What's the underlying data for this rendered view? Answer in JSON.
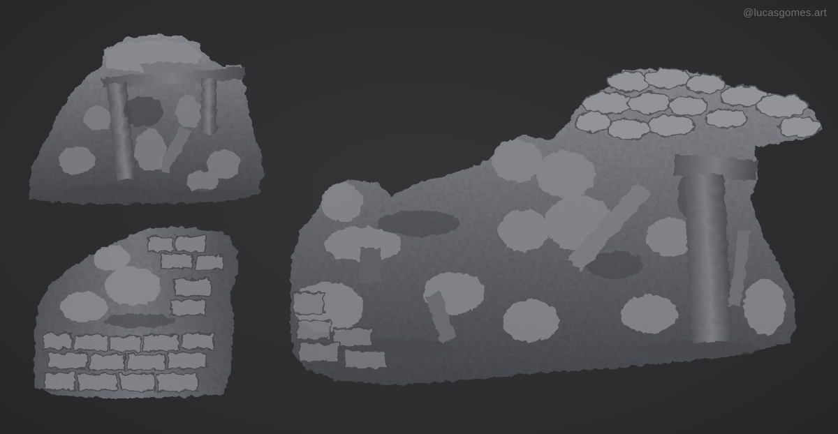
{
  "watermark": {
    "text": "@lucasgomes.art"
  },
  "colors": {
    "background": "#2d2d2f",
    "rock_base": "#6a6b70",
    "rock_light": "#9a9ba1",
    "rock_dark": "#3c3d41",
    "watermark": "#6e6e72"
  },
  "views": [
    {
      "name": "top-left-view"
    },
    {
      "name": "bottom-left-view"
    },
    {
      "name": "main-right-view"
    }
  ]
}
